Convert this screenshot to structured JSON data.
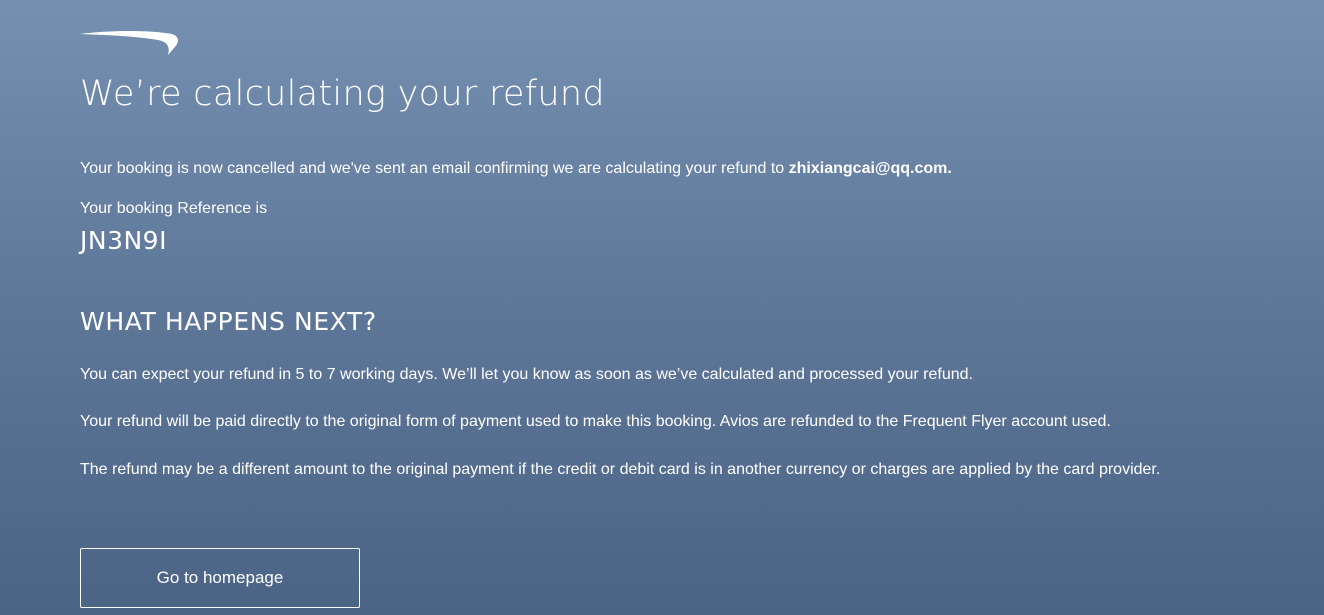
{
  "header": {
    "logo_icon": "speedmarque-logo-icon"
  },
  "main": {
    "title": "We’re calculating your refund",
    "confirmation": {
      "text": "Your booking is now cancelled and we've sent an email confirming we are calculating your refund to ",
      "email": "zhixiangcai@qq.com."
    },
    "booking_reference": {
      "label": "Your booking Reference is",
      "code": "JN3N9I"
    },
    "next_steps": {
      "heading": "WHAT HAPPENS NEXT?",
      "paragraphs": [
        "You can expect your refund in 5 to 7 working days. We’ll let you know as soon as we’ve calculated and processed your refund.",
        "Your refund will be paid directly to the original form of payment used to make this booking. Avios are refunded to the Frequent Flyer account used.",
        "The refund may be a different amount to the original payment if the credit or debit card is in another currency or charges are applied by the card provider."
      ]
    },
    "home_button_label": "Go to homepage"
  },
  "colors": {
    "background_top": "#7690b2",
    "background_bottom": "#4b6385",
    "text": "#ffffff"
  }
}
